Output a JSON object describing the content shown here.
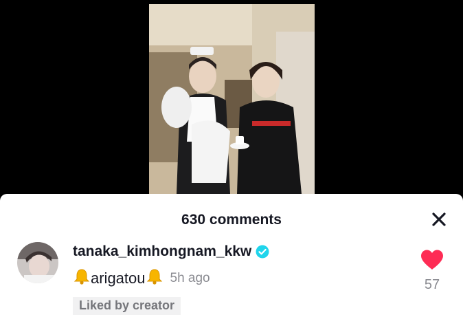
{
  "video": {
    "thumbnail": "video-thumbnail"
  },
  "comments_panel": {
    "count_label": "630 comments",
    "close_icon": "close-icon"
  },
  "comment": {
    "avatar": "user-avatar",
    "username": "tanaka_kimhongnam_kkw",
    "verified_icon": "verified-badge-icon",
    "bell_icon": "bell-emoji-icon",
    "text": "arigatou",
    "time": "5h ago",
    "liked_by": "Liked by creator",
    "like_icon": "heart-icon",
    "like_color": "#fe2c55",
    "like_count": "57"
  }
}
